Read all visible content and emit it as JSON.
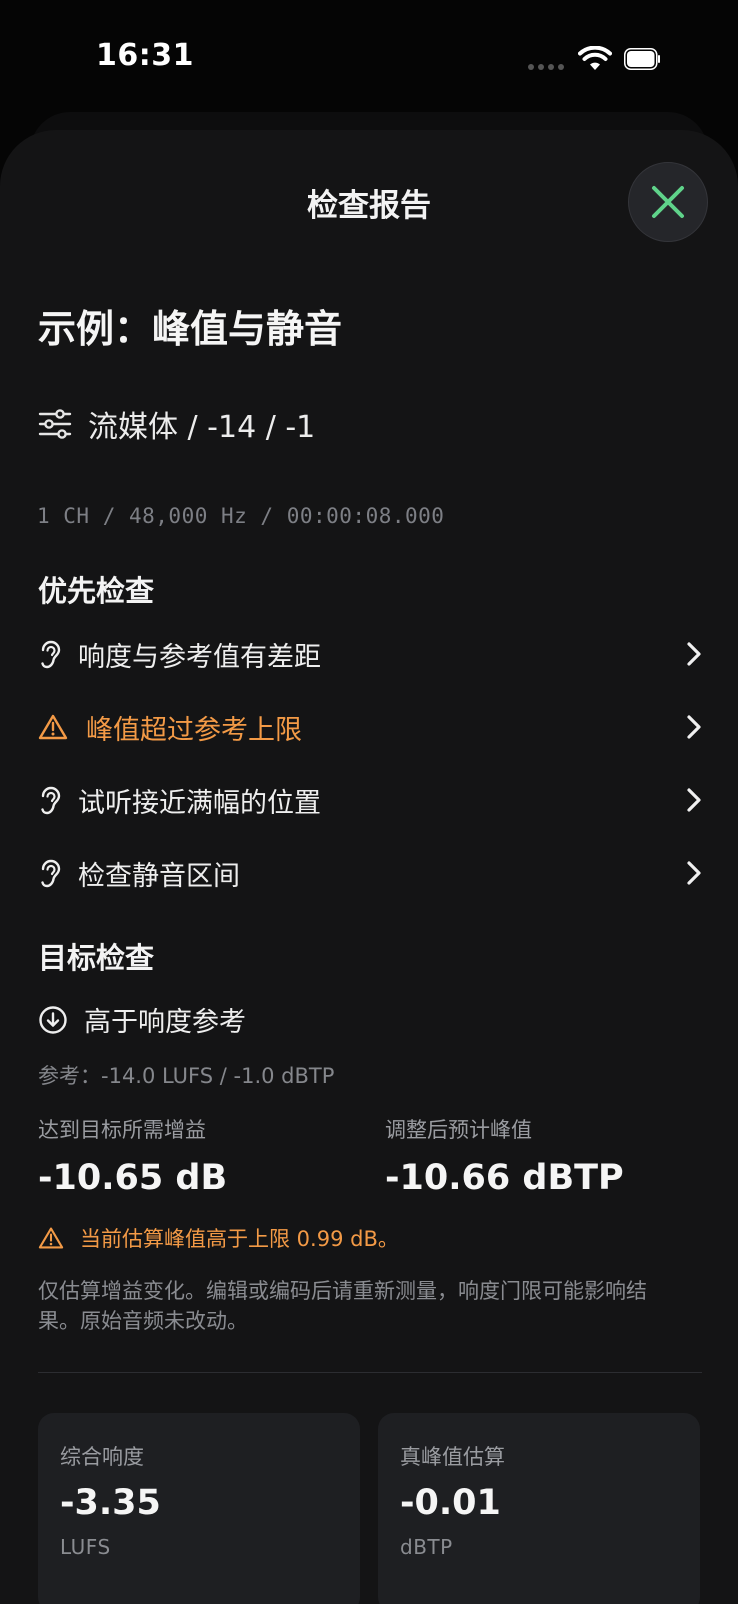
{
  "status_bar": {
    "time": "16:31"
  },
  "sheet": {
    "title": "检查报告",
    "close_icon": "close-x-icon"
  },
  "report": {
    "title": "示例：峰值与静音",
    "preset_icon": "sliders-icon",
    "preset": "流媒体 / -14 / -1",
    "file_meta": "1 CH / 48,000 Hz / 00:00:08.000"
  },
  "priority": {
    "heading": "优先检查",
    "items": [
      {
        "icon": "ear-icon",
        "label": "响度与参考值有差距",
        "warning": false
      },
      {
        "icon": "warning-triangle-icon",
        "label": "峰值超过参考上限",
        "warning": true
      },
      {
        "icon": "ear-icon",
        "label": "试听接近满幅的位置",
        "warning": false
      },
      {
        "icon": "ear-icon",
        "label": "检查静音区间",
        "warning": false
      }
    ]
  },
  "target": {
    "heading": "目标检查",
    "status_icon": "arrow-down-circle-icon",
    "status": "高于响度参考",
    "reference": "参考：-14.0 LUFS / -1.0 dBTP",
    "gain_caption": "达到目标所需增益",
    "gain_value": "-10.65 dB",
    "peak_caption": "调整后预计峰值",
    "peak_value": "-10.66 dBTP",
    "warning": "当前估算峰值高于上限 0.99 dB。",
    "note": "仅估算增益变化。编辑或编码后请重新测量，响度门限可能影响结果。原始音频未改动。"
  },
  "stats": [
    {
      "caption": "综合响度",
      "value": "-3.35",
      "unit": "LUFS"
    },
    {
      "caption": "真峰值估算",
      "value": "-0.01",
      "unit": "dBTP"
    }
  ],
  "colors": {
    "background": "#141415",
    "accent_green": "#5fd38a",
    "warning_orange": "#f39a46"
  }
}
